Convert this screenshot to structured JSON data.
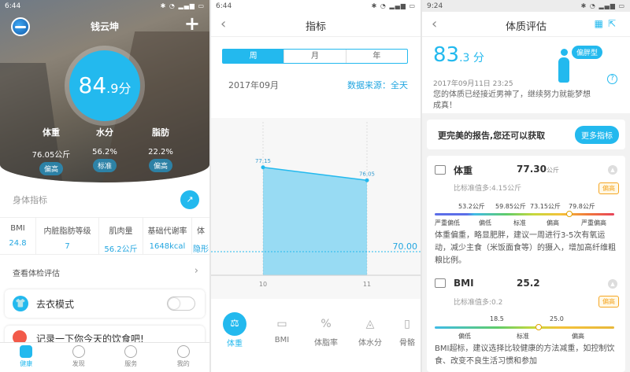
{
  "screen1": {
    "status_time": "6:44",
    "username": "钱云坤",
    "score_int": "84",
    "score_dec": ".9分",
    "metrics": [
      {
        "label": "体重",
        "value": "76.05公斤",
        "tag": "偏高"
      },
      {
        "label": "水分",
        "value": "56.2%",
        "tag": "标准"
      },
      {
        "label": "脂肪",
        "value": "22.2%",
        "tag": "偏高"
      }
    ],
    "section_title": "身体指标",
    "indices": [
      {
        "header": "BMI",
        "value": "24.8"
      },
      {
        "header": "内脏脂肪等级",
        "value": "7"
      },
      {
        "header": "肌肉量",
        "value": "56.2公斤"
      },
      {
        "header": "基础代谢率",
        "value": "1648kcal"
      },
      {
        "header": "体",
        "value": "隐形"
      }
    ],
    "exam_link": "查看体检评估",
    "undress_mode": "去衣模式",
    "food_card": "记录一下你今天的饮食吧!",
    "tabs": [
      {
        "label": "健康"
      },
      {
        "label": "发现"
      },
      {
        "label": "服务"
      },
      {
        "label": "我的"
      }
    ]
  },
  "screen2": {
    "status_time": "6:44",
    "title": "指标",
    "segments": [
      "周",
      "月",
      "年"
    ],
    "month": "2017年09月",
    "source": "数据来源：全天",
    "metrics": [
      {
        "label": "体重"
      },
      {
        "label": "BMI"
      },
      {
        "label": "体脂率"
      },
      {
        "label": "体水分"
      },
      {
        "label": "骨骼"
      }
    ]
  },
  "chart_data": {
    "type": "area",
    "x": [
      "10",
      "11"
    ],
    "series": [
      {
        "values": [
          77.15,
          76.05
        ]
      }
    ],
    "reference_line": {
      "value": 70.0,
      "label": "70.00"
    },
    "grid": false
  },
  "screen3": {
    "status_time": "9:24",
    "title": "体质评估",
    "score_int": "83",
    "score_dec": ".3 分",
    "body_type": "偏胖型",
    "date": "2017年09月11日 23:25",
    "desc": "您的体质已经接近男神了，继续努力就能梦想成真！",
    "promo_text": "更完美的报告,您还可以获取",
    "promo_button": "更多指标",
    "weight": {
      "title": "体重",
      "value": "77.30",
      "unit": "公斤",
      "sub": "比标准值多:4.15公斤",
      "badge": "偏高",
      "ticks": [
        "53.2公斤",
        "59.85公斤",
        "73.15公斤",
        "79.8公斤"
      ],
      "levels": [
        "严重偏低",
        "偏低",
        "标准",
        "偏高",
        "严重偏高"
      ],
      "desc": "体重偏重，略显肥胖，建议一周进行3-5次有氧运动，减少主食（米饭面食等）的摄入，增加高纤维粗粮比例。",
      "marker_fraction": 0.75
    },
    "bmi": {
      "title": "BMI",
      "value": "25.2",
      "sub": "比标准值多:0.2",
      "badge": "偏高",
      "ticks": [
        "18.5",
        "25.0"
      ],
      "levels": [
        "偏低",
        "标准",
        "偏高"
      ],
      "desc": "BMI超标，建议选择比较健康的方法减重，如控制饮食、改变不良生活习惯和参加",
      "marker_fraction": 0.58
    }
  }
}
